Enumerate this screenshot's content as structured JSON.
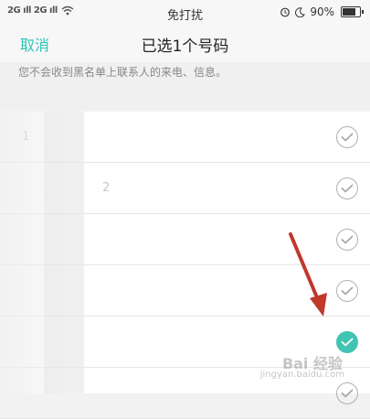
{
  "status_bar": {
    "signal_text": "2G ıll 2G ıll",
    "dnd_title": "免打扰",
    "battery_percent": "90%",
    "battery_level": 0.9
  },
  "header": {
    "cancel_label": "取消",
    "title": "已选1个号码"
  },
  "notice": {
    "text": "您不会收到黑名单上联系人的来电、信息。"
  },
  "contacts": [
    {
      "number_fragment": "1",
      "selected": false
    },
    {
      "number_fragment": "2",
      "selected": false
    },
    {
      "number_fragment": "",
      "selected": false
    },
    {
      "number_fragment": "",
      "selected": false
    },
    {
      "number_fragment": "",
      "selected": true
    },
    {
      "number_fragment": "",
      "selected": false
    }
  ],
  "watermark": {
    "text": "Bai 经验",
    "sub": "jingyan.baidu.com"
  },
  "colors": {
    "accent": "#2ec4b6",
    "selected_check": "#41c4b3",
    "arrow": "#c0392b"
  }
}
